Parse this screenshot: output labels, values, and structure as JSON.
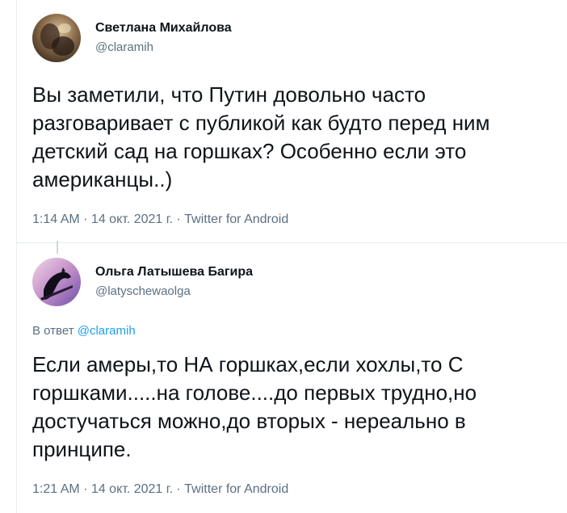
{
  "tweets": [
    {
      "display_name": "Светлана Михайлова",
      "handle": "@claramih",
      "text": "Вы заметили, что Путин довольно часто\nразговаривает с публикой как будто перед ним\nдетский сад на горшках? Особенно если это\nамериканцы..)",
      "meta": "1:14 AM · 14 окт. 2021 г. · Twitter for Android"
    },
    {
      "display_name": "Ольга Латышева Багира",
      "handle": "@latyschewaolga",
      "reply_prefix": "В ответ",
      "reply_to": "@claramih",
      "text": "Если амеры,то НА горшках,если хохлы,то С\nгоршками.....на голове....до первых трудно,но\nдостучаться можно,до вторых - нереально в\nпринципе.",
      "meta": "1:21 AM · 14 окт. 2021 г. · Twitter for Android"
    }
  ],
  "colors": {
    "text": "#0f1419",
    "secondary": "#5b7083",
    "link": "#1da1f2",
    "border": "#e6ecf0"
  }
}
